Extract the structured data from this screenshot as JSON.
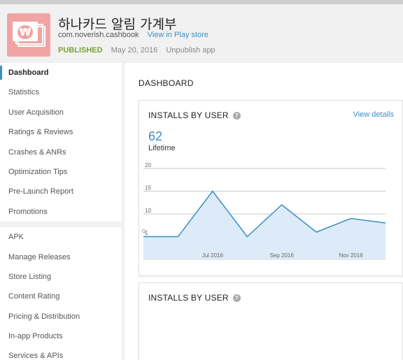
{
  "app": {
    "title": "하나카드 알림 가계부",
    "package": "com.noverish.cashbook",
    "play_link": "View in Play store",
    "status": "PUBLISHED",
    "date": "May 20, 2016",
    "unpublish": "Unpublish app",
    "icon": "banknote-won-icon",
    "icon_glyph": "₩"
  },
  "sidebar": {
    "groups": [
      [
        "Dashboard",
        "Statistics",
        "User Acquisition",
        "Ratings & Reviews",
        "Crashes & ANRs",
        "Optimization Tips",
        "Pre-Launch Report",
        "Promotions"
      ],
      [
        "APK",
        "Manage Releases",
        "Store Listing",
        "Content Rating",
        "Pricing & Distribution",
        "In-app Products",
        "Services & APIs"
      ]
    ],
    "active": "Dashboard"
  },
  "main": {
    "title": "DASHBOARD",
    "card1": {
      "title": "INSTALLS BY USER",
      "view_details": "View details",
      "value": "62",
      "value_label": "Lifetime"
    },
    "card2": {
      "title": "INSTALLS BY USER"
    }
  },
  "colors": {
    "accent": "#3d8ec6",
    "published": "#7aa333",
    "chart_fill": "#dcebf7"
  },
  "chart_data": {
    "type": "area",
    "x": [
      "Jun 2016",
      "Jun 2016",
      "Jul 2016",
      "Aug 2016",
      "Sep 2016",
      "Oct 2016",
      "Nov 2016",
      "Dec 2016"
    ],
    "values": [
      5,
      5,
      15,
      5,
      12,
      6,
      9,
      8
    ],
    "y_ticks": [
      5,
      10,
      15,
      20
    ],
    "x_ticks": [
      "Jul 2016",
      "Sep 2016",
      "Nov 2016"
    ],
    "ylim": [
      0,
      20
    ],
    "grid": true
  }
}
